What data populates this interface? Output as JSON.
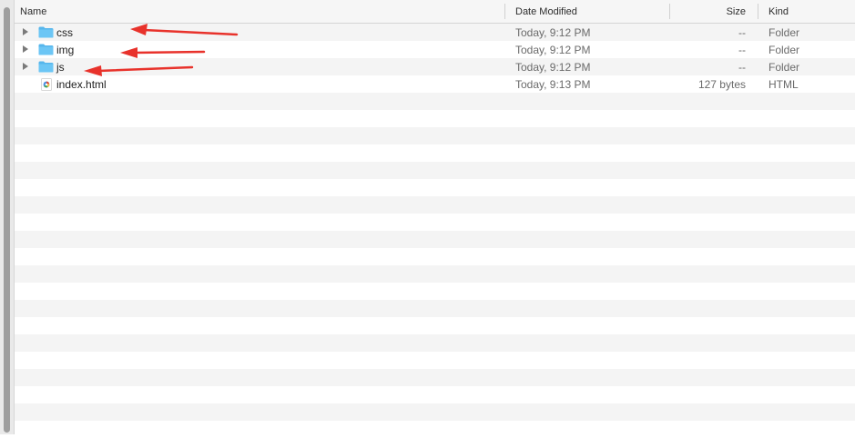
{
  "columns": {
    "name": "Name",
    "date_modified": "Date Modified",
    "size": "Size",
    "kind": "Kind"
  },
  "rows": [
    {
      "name": "css",
      "date": "Today, 9:12 PM",
      "size": "--",
      "kind": "Folder",
      "icon": "folder-icon",
      "expandable": true
    },
    {
      "name": "img",
      "date": "Today, 9:12 PM",
      "size": "--",
      "kind": "Folder",
      "icon": "folder-icon",
      "expandable": true
    },
    {
      "name": "js",
      "date": "Today, 9:12 PM",
      "size": "--",
      "kind": "Folder",
      "icon": "folder-icon",
      "expandable": true
    },
    {
      "name": "index.html",
      "date": "Today, 9:13 PM",
      "size": "127 bytes",
      "kind": "HTML",
      "icon": "html-file-icon",
      "expandable": false
    }
  ],
  "colors": {
    "folder": "#6cc6f5",
    "folder_tab": "#56b6ec",
    "annotation_arrow": "#e8322b",
    "alt_row": "#f4f4f4"
  }
}
